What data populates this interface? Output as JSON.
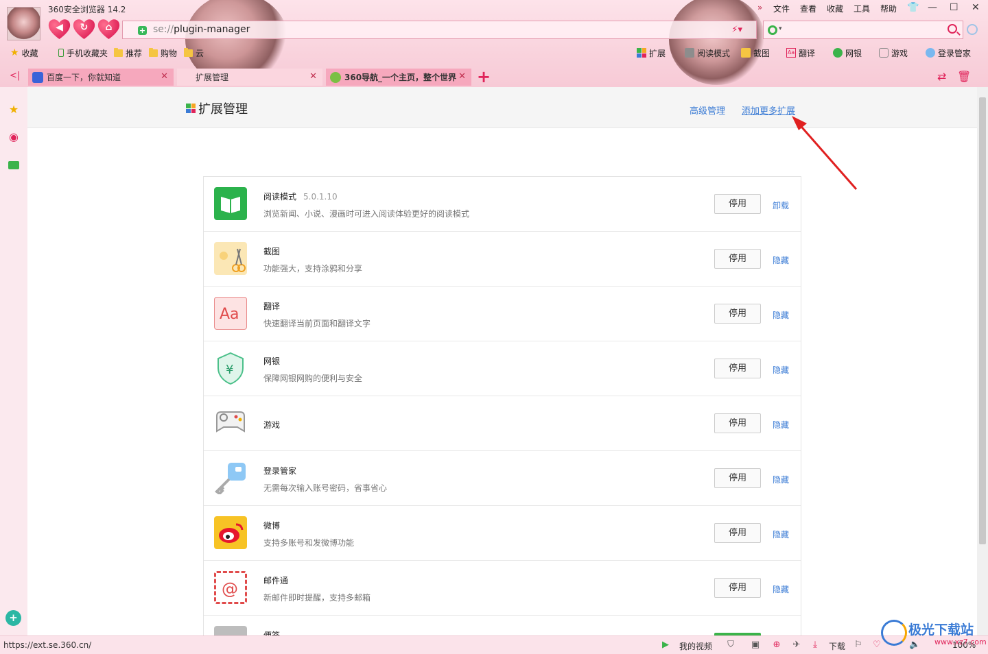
{
  "window": {
    "title": "360安全浏览器 14.2",
    "menu": [
      "»",
      "文件",
      "查看",
      "收藏",
      "工具",
      "帮助"
    ]
  },
  "address_bar": {
    "scheme": "se://",
    "path": "plugin-manager"
  },
  "bookmarks": {
    "left": [
      {
        "label": "收藏",
        "icon": "star-icon"
      },
      {
        "label": "手机收藏夹",
        "icon": "phone-icon"
      },
      {
        "label": "推荐",
        "icon": "folder-icon"
      },
      {
        "label": "购物",
        "icon": "folder-icon"
      },
      {
        "label": "云",
        "icon": "folder-icon"
      }
    ],
    "right": [
      {
        "label": "扩展",
        "icon": "extension-icon"
      },
      {
        "label": "阅读模式",
        "icon": "book-icon"
      },
      {
        "label": "截图",
        "icon": "screenshot-icon"
      },
      {
        "label": "翻译",
        "icon": "translate-icon"
      },
      {
        "label": "网银",
        "icon": "bank-icon"
      },
      {
        "label": "游戏",
        "icon": "game-icon"
      },
      {
        "label": "登录管家",
        "icon": "key-icon"
      }
    ]
  },
  "tabs": [
    {
      "title": "百度一下，你就知道",
      "icon": "baidu-icon"
    },
    {
      "title": "扩展管理",
      "icon": "extension-icon"
    },
    {
      "title": "360导航_一个主页，整个世界",
      "icon": "360-icon"
    }
  ],
  "page": {
    "title": "扩展管理",
    "links": {
      "advanced": "高级管理",
      "add_more": "添加更多扩展"
    }
  },
  "extensions": [
    {
      "name": "阅读模式",
      "version": "5.0.1.10",
      "desc": "浏览新闻、小说、漫画时可进入阅读体验更好的阅读模式",
      "button": "停用",
      "link": "卸载",
      "icon": "reader-icon",
      "color": "#2bb24c"
    },
    {
      "name": "截图",
      "version": "",
      "desc": "功能强大，支持涂鸦和分享",
      "button": "停用",
      "link": "隐藏",
      "icon": "scissors-icon",
      "color": "#f9d98c"
    },
    {
      "name": "翻译",
      "version": "",
      "desc": "快速翻译当前页面和翻译文字",
      "button": "停用",
      "link": "隐藏",
      "icon": "translate-icon",
      "color": "#fde3e3"
    },
    {
      "name": "网银",
      "version": "",
      "desc": "保障网银网购的便利与安全",
      "button": "停用",
      "link": "隐藏",
      "icon": "bank-shield-icon",
      "color": "#4cc08a"
    },
    {
      "name": "游戏",
      "version": "",
      "desc": "",
      "button": "停用",
      "link": "隐藏",
      "icon": "gamepad-icon",
      "color": "#e6e6e6"
    },
    {
      "name": "登录管家",
      "version": "",
      "desc": "无需每次输入账号密码，省事省心",
      "button": "停用",
      "link": "隐藏",
      "icon": "key-icon",
      "color": "#8ec8f5"
    },
    {
      "name": "微博",
      "version": "",
      "desc": "支持多账号和发微博功能",
      "button": "停用",
      "link": "隐藏",
      "icon": "weibo-icon",
      "color": "#f7c325"
    },
    {
      "name": "邮件通",
      "version": "",
      "desc": "新邮件即时提醒，支持多邮箱",
      "button": "停用",
      "link": "隐藏",
      "icon": "mail-icon",
      "color": "#f4f4f4"
    },
    {
      "name": "便签",
      "version": "",
      "desc": "",
      "button": "",
      "link": "",
      "icon": "note-icon",
      "color": "#bdbdbd"
    }
  ],
  "status_bar": {
    "url": "https://ext.se.360.cn/",
    "items": [
      "我的视频",
      "下载"
    ],
    "zoom": "100%"
  },
  "watermark": {
    "text": "极光下载站",
    "url": "www.xz7.com"
  },
  "colors": {
    "accent": "#e0245a",
    "link": "#3a7bd5",
    "green": "#3bb34a"
  }
}
